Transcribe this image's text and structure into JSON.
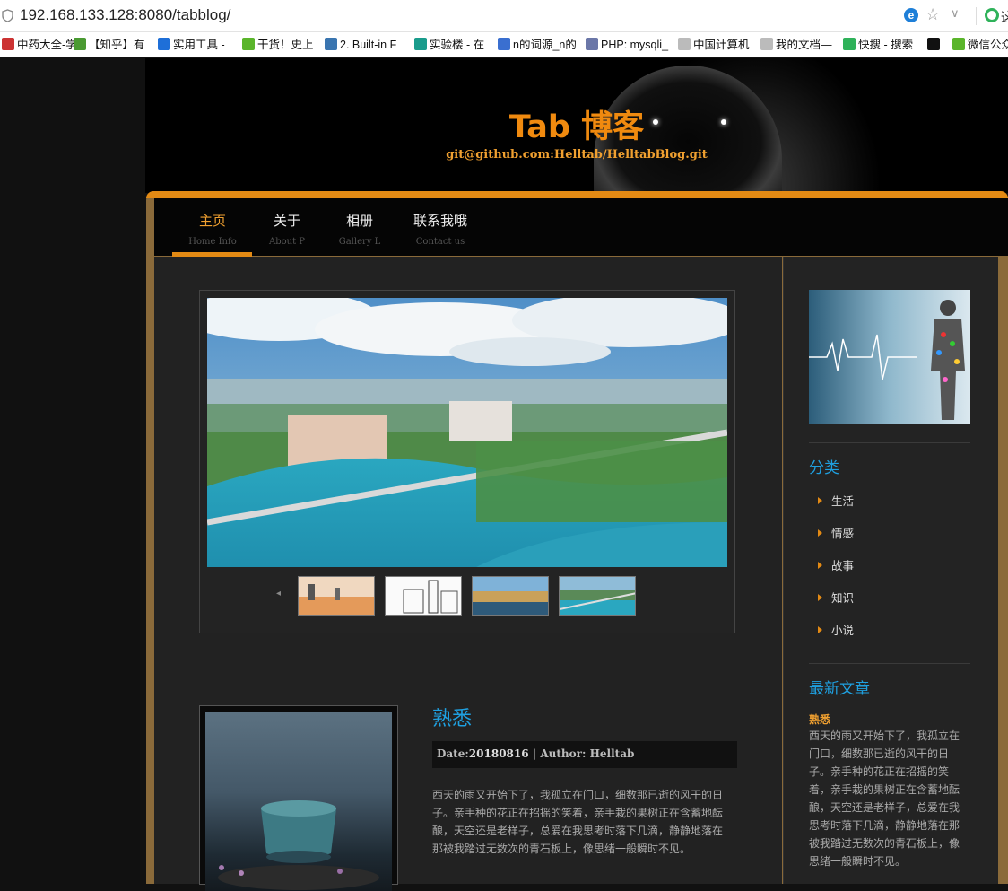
{
  "browser": {
    "url": "192.168.133.128:8080/tabblog/",
    "search_cut": "这",
    "bookmarks": [
      {
        "label": "中药大全-学",
        "icon": "bookmark-icon",
        "color": "#c33"
      },
      {
        "label": "【知乎】有",
        "icon": "zhihu-icon",
        "color": "#4a9a32"
      },
      {
        "label": "实用工具 -",
        "icon": "drop-icon",
        "color": "#1e6fd8"
      },
      {
        "label": "干货！史上",
        "icon": "wechat-icon",
        "color": "#5ab52b"
      },
      {
        "label": "2. Built-in F",
        "icon": "python-icon",
        "color": "#3a75b0"
      },
      {
        "label": "实验楼 - 在",
        "icon": "shiyanlou-icon",
        "color": "#1a9c8c"
      },
      {
        "label": "n的词源_n的",
        "icon": "globe-icon",
        "color": "#3a6fd0"
      },
      {
        "label": "PHP: mysqli_",
        "icon": "php-icon",
        "color": "#6b77a8"
      },
      {
        "label": "中国计算机",
        "icon": "page-icon",
        "color": "#bbb"
      },
      {
        "label": "我的文档—",
        "icon": "page-icon",
        "color": "#bbb"
      },
      {
        "label": "快搜 - 搜索",
        "icon": "kuaisou-icon",
        "color": "#2fb25a"
      },
      {
        "label": "",
        "icon": "va-icon",
        "color": "#111"
      },
      {
        "label": "微信公众",
        "icon": "wechat-icon",
        "color": "#5ab52b"
      }
    ]
  },
  "site": {
    "title": "Tab 博客",
    "subtitle": "git@github.com:Helltab/HelltabBlog.git"
  },
  "nav": [
    {
      "zh": "主页",
      "en": "Home Info",
      "active": true
    },
    {
      "zh": "关于",
      "en": "About P",
      "active": false
    },
    {
      "zh": "相册",
      "en": "Gallery L",
      "active": false
    },
    {
      "zh": "联系我哦",
      "en": "Contact us",
      "active": false
    }
  ],
  "post": {
    "title": "熟悉",
    "date_label": "Date:",
    "date": "20180816",
    "author_label": "| Author:",
    "author": "Helltab",
    "body": "西天的雨又开始下了，我孤立在门口，细数那已逝的风干的日子。亲手种的花正在招摇的笑着，亲手栽的果树正在含蓄地酝酿，天空还是老样子，总爱在我思考时落下几滴，静静地落在那被我踏过无数次的青石板上，像思绪一般瞬时不见。"
  },
  "sidebar": {
    "category_heading": "分类",
    "categories": [
      "生活",
      "情感",
      "故事",
      "知识",
      "小说"
    ],
    "latest_heading": "最新文章",
    "latest_title": "熟悉",
    "latest_body": "西天的雨又开始下了，我孤立在门口，细数那已逝的风干的日子。亲手种的花正在招摇的笑着，亲手栽的果树正在含蓄地酝酿，天空还是老样子，总爱在我思考时落下几滴，静静地落在那被我踏过无数次的青石板上，像思绪一般瞬时不见。"
  },
  "colors": {
    "accent_orange": "#e38a14",
    "link_blue": "#1fa0e0"
  }
}
